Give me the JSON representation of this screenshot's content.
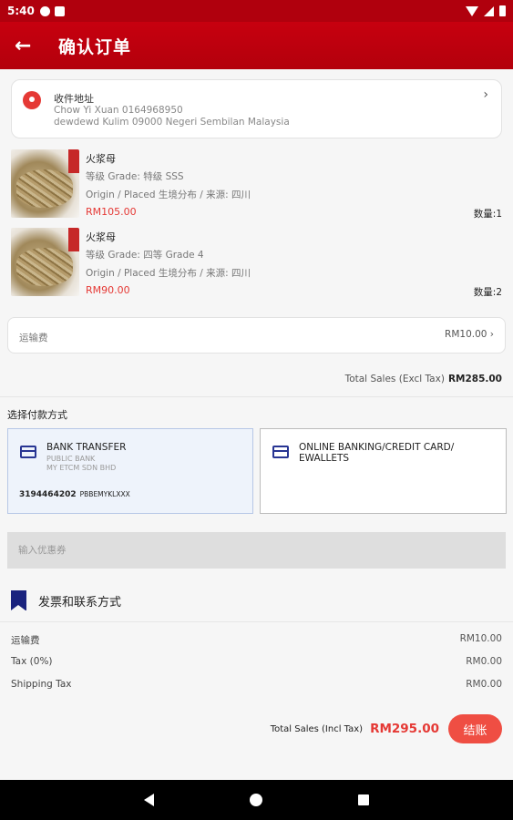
{
  "status_bar": {
    "time": "5:40"
  },
  "header": {
    "back_icon": "arrow-left-icon",
    "title": "确认订单"
  },
  "address": {
    "label": "收件地址",
    "name_phone": "Chow Yi Xuan 0164968950",
    "full_address": "dewdewd  Kulim 09000 Negeri Sembilan Malaysia",
    "chevron": "›"
  },
  "products": [
    {
      "name": "火浆母",
      "grade": "等级 Grade: 特级 SSS",
      "origin": "Origin / Placed 生境分布 / 来源: 四川",
      "price": "RM105.00",
      "quantity": "数量:1"
    },
    {
      "name": "火浆母",
      "grade": "等级 Grade: 四等 Grade 4",
      "origin": "Origin / Placed 生境分布 / 来源: 四川",
      "price": "RM90.00",
      "quantity": "数量:2"
    }
  ],
  "shipping": {
    "label": "运输费",
    "value": "RM10.00 ›"
  },
  "subtotal": {
    "label": "Total Sales (Excl Tax)",
    "value": "RM285.00"
  },
  "payment": {
    "title": "选择付款方式",
    "options": [
      {
        "title": "BANK TRANSFER",
        "subtitle1": "PUBLIC BANK",
        "subtitle2": "MY ETCM SDN BHD",
        "account": "3194464202",
        "swift": "PBBEMYKLXXX",
        "selected": true
      },
      {
        "title_line1": "ONLINE BANKING/CREDIT CARD/",
        "title_line2": "EWALLETS",
        "selected": false
      }
    ]
  },
  "coupon": {
    "placeholder": "输入优惠券"
  },
  "invoice": {
    "title": "发票和联系方式"
  },
  "summary": [
    {
      "label": "运输费",
      "value": "RM10.00"
    },
    {
      "label": "Tax (0%)",
      "value": "RM0.00"
    },
    {
      "label": "Shipping Tax",
      "value": "RM0.00"
    }
  ],
  "total": {
    "label": "Total Sales (Incl Tax)",
    "value": "RM295.00",
    "button": "结账"
  },
  "colors": {
    "primary": "#c7000f",
    "accent_red": "#e53935",
    "button": "#ef4e43",
    "icon_blue": "#283593"
  }
}
